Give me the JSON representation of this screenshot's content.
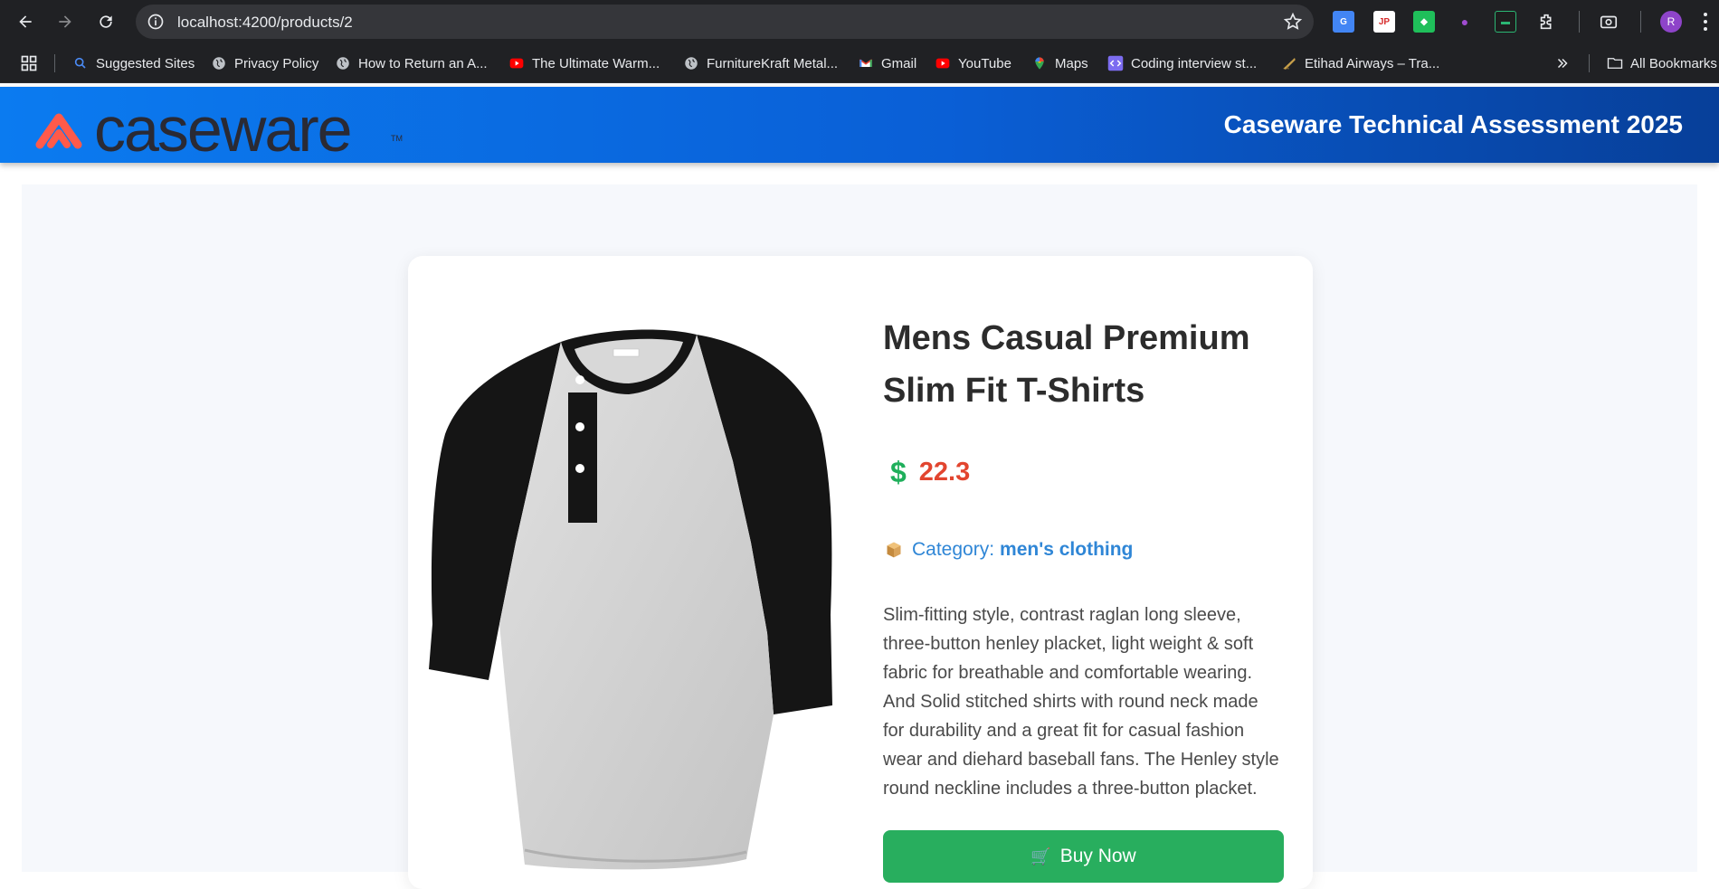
{
  "browser": {
    "url": "localhost:4200/products/2",
    "avatar_letter": "R",
    "bookmarks": [
      {
        "label": "Suggested Sites",
        "icon": "search-icon"
      },
      {
        "label": "Privacy Policy",
        "icon": "globe-icon"
      },
      {
        "label": "How to Return an A...",
        "icon": "globe-icon"
      },
      {
        "label": "The Ultimate Warm...",
        "icon": "youtube-icon"
      },
      {
        "label": "FurnitureKraft Metal...",
        "icon": "globe-icon"
      },
      {
        "label": "Gmail",
        "icon": "gmail-icon"
      },
      {
        "label": "YouTube",
        "icon": "youtube-icon"
      },
      {
        "label": "Maps",
        "icon": "maps-icon"
      },
      {
        "label": "Coding interview st...",
        "icon": "code-icon"
      },
      {
        "label": "Etihad Airways – Tra...",
        "icon": "etihad-icon"
      }
    ],
    "all_bookmarks_label": "All Bookmarks"
  },
  "header": {
    "logo_text": "caseware",
    "title": "Caseware Technical Assessment 2025"
  },
  "product": {
    "title": "Mens Casual Premium Slim Fit T-Shirts",
    "currency_symbol": "$",
    "price": "22.3",
    "category_label": "Category:",
    "category_value": "men's clothing",
    "description": "Slim-fitting style, contrast raglan long sleeve, three-button henley placket, light weight & soft fabric for breathable and comfortable wearing. And Solid stitched shirts with round neck made for durability and a great fit for casual fashion wear and diehard baseball fans. The Henley style round neckline includes a three-button placket.",
    "buy_label": "Buy Now"
  },
  "colors": {
    "header_start": "#0b7bf0",
    "header_end": "#073f99",
    "price": "#e2452f",
    "dollar": "#1faf5b",
    "category": "#2f86d6",
    "buy_button": "#28ae5e"
  }
}
